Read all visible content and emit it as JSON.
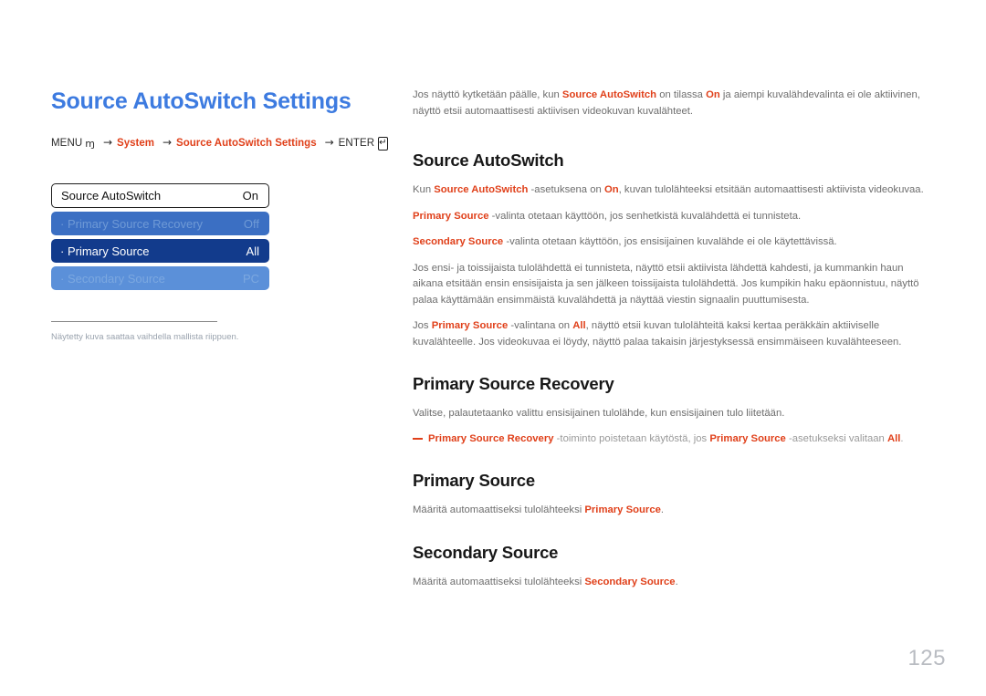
{
  "page": {
    "title": "Source AutoSwitch Settings",
    "number": "125",
    "accent_blue": "#3d7be0",
    "accent_red": "#e0401a",
    "body_gray": "#6e6e6e"
  },
  "breadcrumb": {
    "menu_label": "MENU",
    "menu_glyph": "ɱ",
    "arrow": "→",
    "items": [
      "System",
      "Source AutoSwitch Settings"
    ],
    "enter_label": "ENTER",
    "enter_key_glyph": "↵"
  },
  "osd": {
    "rows": [
      {
        "name": "source-autoswitch",
        "label": "Source AutoSwitch",
        "value": "On",
        "state": "head"
      },
      {
        "name": "primary-source-recovery",
        "label": "· Primary Source Recovery",
        "value": "Off",
        "state": "dim-a"
      },
      {
        "name": "primary-source",
        "label": "· Primary Source",
        "value": "All",
        "state": "selected"
      },
      {
        "name": "secondary-source",
        "label": "· Secondary Source",
        "value": "PC",
        "state": "dim-b"
      }
    ],
    "footnote": "Näytetty kuva saattaa vaihdella mallista riippuen."
  },
  "intro": {
    "p1_a": "Jos näyttö kytketään päälle, kun ",
    "p1_t1": "Source AutoSwitch",
    "p1_b": " on tilassa ",
    "p1_t2": "On",
    "p1_c": " ja aiempi kuvalähdevalinta ei ole aktiivinen, näyttö etsii automaattisesti aktiivisen videokuvan kuvalähteet."
  },
  "sections": [
    {
      "name": "source-autoswitch",
      "heading": "Source AutoSwitch",
      "paragraphs": [
        {
          "parts": [
            {
              "t": "Kun ",
              "s": "n"
            },
            {
              "t": "Source AutoSwitch",
              "s": "r"
            },
            {
              "t": " -asetuksena on ",
              "s": "n"
            },
            {
              "t": "On",
              "s": "r"
            },
            {
              "t": ", kuvan tulolähteeksi etsitään automaattisesti aktiivista videokuvaa.",
              "s": "n"
            }
          ]
        },
        {
          "parts": [
            {
              "t": "Primary Source",
              "s": "r"
            },
            {
              "t": " -valinta otetaan käyttöön, jos senhetkistä kuvalähdettä ei tunnisteta.",
              "s": "n"
            }
          ]
        },
        {
          "parts": [
            {
              "t": "Secondary Source",
              "s": "r"
            },
            {
              "t": " -valinta otetaan käyttöön, jos ensisijainen kuvalähde ei ole käytettävissä.",
              "s": "n"
            }
          ]
        },
        {
          "parts": [
            {
              "t": "Jos ensi- ja toissijaista tulolähdettä ei tunnisteta, näyttö etsii aktiivista lähdettä kahdesti, ja kummankin haun aikana etsitään ensin ensisijaista ja sen jälkeen toissijaista tulolähdettä. Jos kumpikin haku epäonnistuu, näyttö palaa käyttämään ensimmäistä kuvalähdettä ja näyttää viestin signaalin puuttumisesta.",
              "s": "n"
            }
          ]
        },
        {
          "parts": [
            {
              "t": "Jos ",
              "s": "n"
            },
            {
              "t": "Primary Source",
              "s": "r"
            },
            {
              "t": " -valintana on ",
              "s": "n"
            },
            {
              "t": "All",
              "s": "r"
            },
            {
              "t": ", näyttö etsii kuvan tulolähteitä kaksi kertaa peräkkäin aktiiviselle kuvalähteelle. Jos videokuvaa ei löydy, näyttö palaa takaisin järjestyksessä ensimmäiseen kuvalähteeseen.",
              "s": "n"
            }
          ]
        }
      ]
    },
    {
      "name": "primary-source-recovery",
      "heading": "Primary Source Recovery",
      "paragraphs": [
        {
          "parts": [
            {
              "t": "Valitse, palautetaanko valittu ensisijainen tulolähde, kun ensisijainen tulo liitetään.",
              "s": "n"
            }
          ]
        }
      ],
      "note": {
        "parts": [
          {
            "t": "Primary Source Recovery",
            "s": "r"
          },
          {
            "t": " -toiminto poistetaan käytöstä, jos ",
            "s": "n"
          },
          {
            "t": "Primary Source",
            "s": "r"
          },
          {
            "t": " -asetukseksi valitaan ",
            "s": "n"
          },
          {
            "t": "All",
            "s": "r"
          },
          {
            "t": ".",
            "s": "n"
          }
        ]
      }
    },
    {
      "name": "primary-source",
      "heading": "Primary Source",
      "paragraphs": [
        {
          "parts": [
            {
              "t": "Määritä automaattiseksi tulolähteeksi ",
              "s": "n"
            },
            {
              "t": "Primary Source",
              "s": "r"
            },
            {
              "t": ".",
              "s": "n"
            }
          ]
        }
      ]
    },
    {
      "name": "secondary-source",
      "heading": "Secondary Source",
      "paragraphs": [
        {
          "parts": [
            {
              "t": "Määritä automaattiseksi tulolähteeksi ",
              "s": "n"
            },
            {
              "t": "Secondary Source",
              "s": "r"
            },
            {
              "t": ".",
              "s": "n"
            }
          ]
        }
      ]
    }
  ]
}
